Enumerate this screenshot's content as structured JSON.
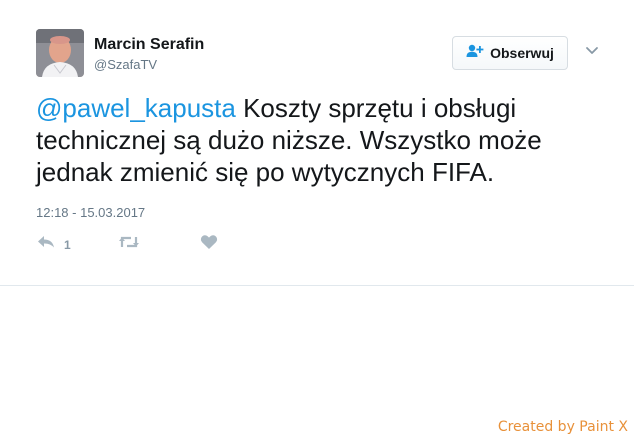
{
  "user": {
    "name": "Marcin Serafin",
    "handle": "@SzafaTV"
  },
  "follow_button": {
    "label": "Obserwuj"
  },
  "tweet": {
    "mention": "@pawel_kapusta",
    "text": " Koszty sprzętu i obsługi technicznej są dużo niższe. Wszystko może jednak zmienić się po wytycznych FIFA.",
    "timestamp": "12:18 - 15.03.2017"
  },
  "actions": {
    "reply_count": "1"
  },
  "watermark": "Created by Paint X",
  "icons": [
    "avatar",
    "add-user-icon",
    "chevron-down-icon",
    "reply-icon",
    "retweet-icon",
    "like-icon"
  ],
  "colors": {
    "mention": "#1b95e0",
    "meta": "#657786",
    "action_icon": "#aab8c2",
    "watermark": "#e8913a"
  }
}
